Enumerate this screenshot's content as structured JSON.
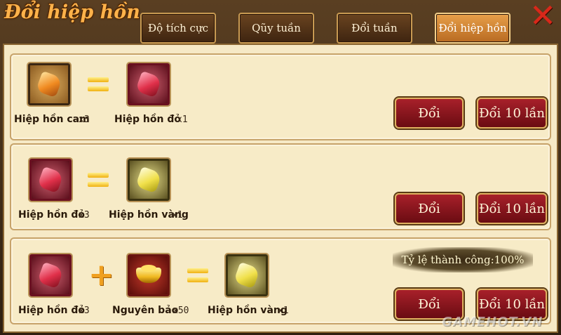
{
  "window": {
    "title": "Đổi hiệp hồn",
    "close_icon": "close-x-icon"
  },
  "tabs": [
    {
      "label": "Độ tích cực",
      "active": false
    },
    {
      "label": "Qũy tuần",
      "active": false
    },
    {
      "label": "Đổi tuần",
      "active": false
    },
    {
      "label": "Đổi hiệp hồn",
      "active": true
    }
  ],
  "recipes": [
    {
      "inputs": [
        {
          "name": "Hiệp hồn cam",
          "qty": "x3",
          "icon": "orange-gem-icon"
        }
      ],
      "output": {
        "name": "Hiệp hồn đỏ",
        "qty": "x1",
        "icon": "red-gem-icon"
      },
      "exchange_label": "Đổi",
      "exchange10_label": "Đổi 10 lần"
    },
    {
      "inputs": [
        {
          "name": "Hiệp hồn đỏ",
          "qty": "x3",
          "icon": "red-gem-icon"
        }
      ],
      "output": {
        "name": "Hiệp hồn vàng",
        "qty": "x1",
        "icon": "yellow-gem-icon"
      },
      "exchange_label": "Đổi",
      "exchange10_label": "Đổi 10 lần"
    },
    {
      "inputs": [
        {
          "name": "Hiệp hồn đỏ",
          "qty": "x3",
          "icon": "red-gem-icon"
        },
        {
          "name": "Nguyên bảo",
          "qty": "x50",
          "icon": "gold-ingot-icon"
        }
      ],
      "output": {
        "name": "Hiệp hồn vàng",
        "qty": "x1",
        "icon": "yellow-gem-icon"
      },
      "success_rate": "Tỷ lệ thành công:100%",
      "exchange_label": "Đổi",
      "exchange10_label": "Đổi 10 lần"
    }
  ],
  "watermark": "GAMEHOT.VN",
  "colors": {
    "accent": "#f0a020",
    "button": "#8a1620",
    "panel": "#f6e9c6"
  }
}
